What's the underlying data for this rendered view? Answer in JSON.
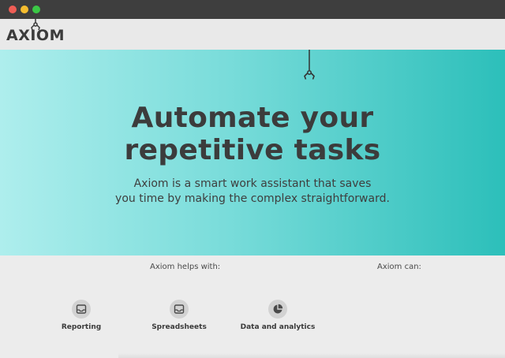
{
  "window": {
    "controls": [
      "close",
      "minimize",
      "maximize"
    ]
  },
  "nav": {
    "logo": "AXIOM",
    "logo_icon": "robot-claw-icon"
  },
  "hero": {
    "headline_line1": "Automate your",
    "headline_line2": "repetitive tasks",
    "subtext_line1": "Axiom is a smart work assistant that saves",
    "subtext_line2": "you time by making the complex straightforward.",
    "claw_icon": "robot-claw-icon",
    "gradient_start": "#aeeeed",
    "gradient_end": "#2cbfba"
  },
  "features": {
    "helps_label": "Axiom helps with:",
    "can_label": "Axiom can:",
    "items": [
      {
        "label": "Reporting",
        "icon": "inbox-icon"
      },
      {
        "label": "Spreadsheets",
        "icon": "inbox-icon"
      },
      {
        "label": "Data and analytics",
        "icon": "pie-chart-icon"
      }
    ]
  }
}
